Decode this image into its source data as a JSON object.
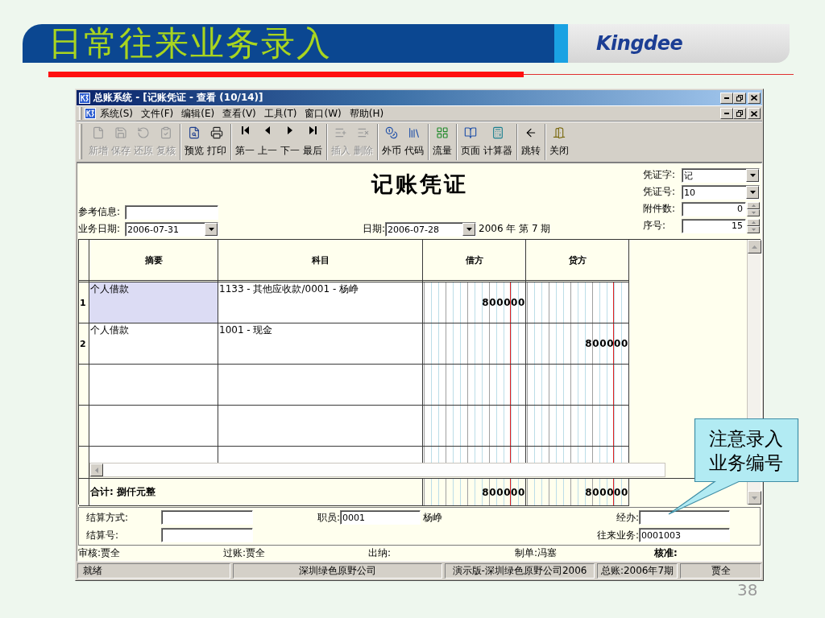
{
  "slide": {
    "title": "日常往来业务录入",
    "logo": "Kingdee",
    "page_number": "38"
  },
  "window": {
    "title": "总账系统 - [记账凭证 - 查看 (10/14)]"
  },
  "menu": [
    "系统(S)",
    "文件(F)",
    "编辑(E)",
    "查看(V)",
    "工具(T)",
    "窗口(W)",
    "帮助(H)"
  ],
  "toolbar": [
    [
      {
        "label": "新增",
        "disabled": true
      },
      {
        "label": "保存",
        "disabled": true
      },
      {
        "label": "还原",
        "disabled": true
      },
      {
        "label": "复核",
        "disabled": true
      }
    ],
    [
      {
        "label": "预览",
        "disabled": false
      },
      {
        "label": "打印",
        "disabled": false
      }
    ],
    [
      {
        "label": "第一",
        "disabled": false
      },
      {
        "label": "上一",
        "disabled": false
      },
      {
        "label": "下一",
        "disabled": false
      },
      {
        "label": "最后",
        "disabled": false
      }
    ],
    [
      {
        "label": "插入",
        "disabled": true
      },
      {
        "label": "删除",
        "disabled": true
      }
    ],
    [
      {
        "label": "外币",
        "disabled": false
      },
      {
        "label": "代码",
        "disabled": false
      }
    ],
    [
      {
        "label": "流量",
        "disabled": false
      }
    ],
    [
      {
        "label": "页面",
        "disabled": false
      },
      {
        "label": "计算器",
        "disabled": false
      }
    ],
    [
      {
        "label": "跳转",
        "disabled": false
      }
    ],
    [
      {
        "label": "关闭",
        "disabled": false
      }
    ]
  ],
  "voucher": {
    "title": "记账凭证",
    "header_fields": [
      {
        "label": "凭证字:",
        "value": "记",
        "kind": "dropdown"
      },
      {
        "label": "凭证号:",
        "value": "10",
        "kind": "dropdown"
      },
      {
        "label": "附件数:",
        "value": "0",
        "kind": "spinner"
      },
      {
        "label": "序号:",
        "value": "15",
        "kind": "spinner"
      }
    ],
    "reference": {
      "label": "参考信息:"
    },
    "business_date": {
      "label": "业务日期:",
      "value": "2006-07-31"
    },
    "date": {
      "label": "日期:",
      "value": "2006-07-28"
    },
    "period": "2006 年 第 7 期"
  },
  "table": {
    "columns": [
      "摘要",
      "科目",
      "借方",
      "贷方"
    ],
    "rows": [
      {
        "number": "1",
        "summary": "个人借款",
        "account": "1133 - 其他应收款/0001 - 杨峥",
        "debit": "800000",
        "selected": true
      },
      {
        "number": "2",
        "summary": "个人借款",
        "account": "1001 - 现金",
        "credit": "800000",
        "selected": false
      }
    ],
    "total": {
      "label": "合计: 捌仟元整",
      "debit": "800000",
      "credit": "800000"
    }
  },
  "settlement": {
    "method": {
      "label": "结算方式:"
    },
    "number": {
      "label": "结算号:"
    },
    "staff": {
      "label": "职员:",
      "value": "0001",
      "name": "杨峥"
    },
    "handler": {
      "label": "经办:"
    },
    "contact_business": {
      "label": "往来业务:",
      "value": "0001003"
    }
  },
  "signatures": [
    {
      "label": "审核:",
      "value": "贾全"
    },
    {
      "label": "过账:",
      "value": "贾全"
    },
    {
      "label": "出纳:"
    },
    {
      "label": "制单:",
      "value": "冯塞"
    },
    {
      "label": "核准:"
    }
  ],
  "status_bar": [
    "就绪",
    "深圳绿色原野公司",
    "演示版-深圳绿色原野公司2006",
    "总账:2006年7期",
    "贾全"
  ],
  "callout": {
    "text": "注意录入业务编号"
  }
}
